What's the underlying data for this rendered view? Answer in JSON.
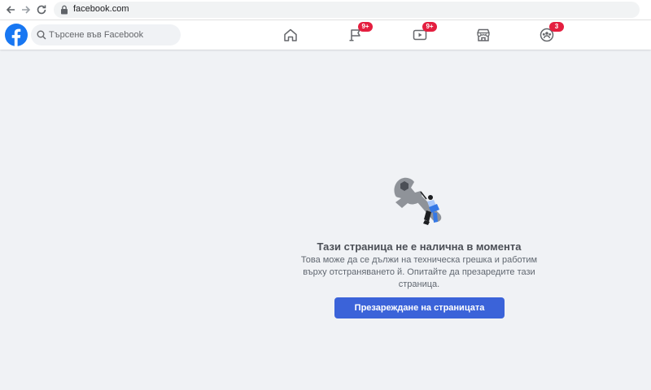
{
  "browser": {
    "url": "facebook.com"
  },
  "header": {
    "search_placeholder": "Търсене във Facebook",
    "nav": [
      {
        "name": "home",
        "badge": ""
      },
      {
        "name": "pages",
        "badge": "9+"
      },
      {
        "name": "watch",
        "badge": "9+"
      },
      {
        "name": "marketplace",
        "badge": ""
      },
      {
        "name": "groups",
        "badge": "3"
      }
    ]
  },
  "error": {
    "title": "Тази страница не е налична в момента",
    "description": "Това може да се дължи на техническа грешка и работим върху отстраняването й. Опитайте да презаредите тази страница.",
    "button_label": "Презареждане на страницата"
  },
  "colors": {
    "brand": "#1877f2",
    "badge": "#e41e3f",
    "button": "#3b63d9",
    "background": "#f0f2f5"
  }
}
